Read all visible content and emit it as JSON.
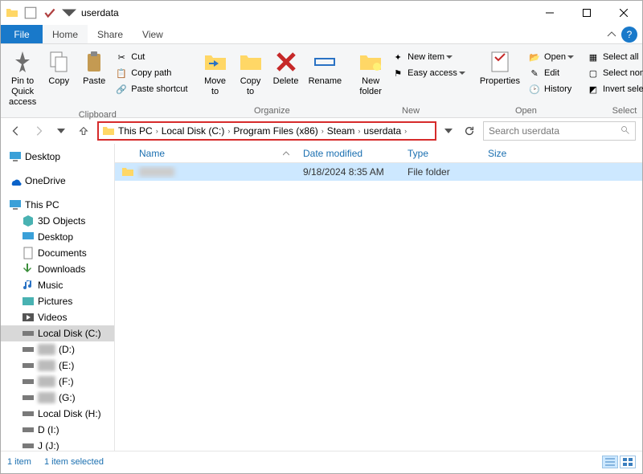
{
  "window": {
    "title": "userdata"
  },
  "tabs": {
    "file": "File",
    "home": "Home",
    "share": "Share",
    "view": "View"
  },
  "ribbon": {
    "pin": "Pin to Quick\naccess",
    "copy": "Copy",
    "paste": "Paste",
    "cut": "Cut",
    "copypath": "Copy path",
    "pasteshortcut": "Paste shortcut",
    "clipboard_group": "Clipboard",
    "moveto": "Move\nto",
    "copyto": "Copy\nto",
    "delete": "Delete",
    "rename": "Rename",
    "organize_group": "Organize",
    "newfolder": "New\nfolder",
    "newitem": "New item",
    "easyaccess": "Easy access",
    "new_group": "New",
    "properties": "Properties",
    "open": "Open",
    "edit": "Edit",
    "history": "History",
    "open_group": "Open",
    "selectall": "Select all",
    "selectnone": "Select none",
    "invert": "Invert selection",
    "select_group": "Select"
  },
  "breadcrumb": [
    "This PC",
    "Local Disk (C:)",
    "Program Files (x86)",
    "Steam",
    "userdata"
  ],
  "search": {
    "placeholder": "Search userdata"
  },
  "tree": {
    "desktop": "Desktop",
    "onedrive": "OneDrive",
    "thispc": "This PC",
    "3dobjects": "3D Objects",
    "desktop2": "Desktop",
    "documents": "Documents",
    "downloads": "Downloads",
    "music": "Music",
    "pictures": "Pictures",
    "videos": "Videos",
    "cdrive": "Local Disk (C:)",
    "d": "(D:)",
    "e": "(E:)",
    "f": "(F:)",
    "g": "(G:)",
    "h": "Local Disk (H:)",
    "di": "D (I:)",
    "jj": "J (J:)"
  },
  "columns": {
    "name": "Name",
    "date": "Date modified",
    "type": "Type",
    "size": "Size"
  },
  "rows": [
    {
      "name": "",
      "date": "9/18/2024 8:35 AM",
      "type": "File folder",
      "size": ""
    }
  ],
  "status": {
    "count": "1 item",
    "selected": "1 item selected"
  }
}
